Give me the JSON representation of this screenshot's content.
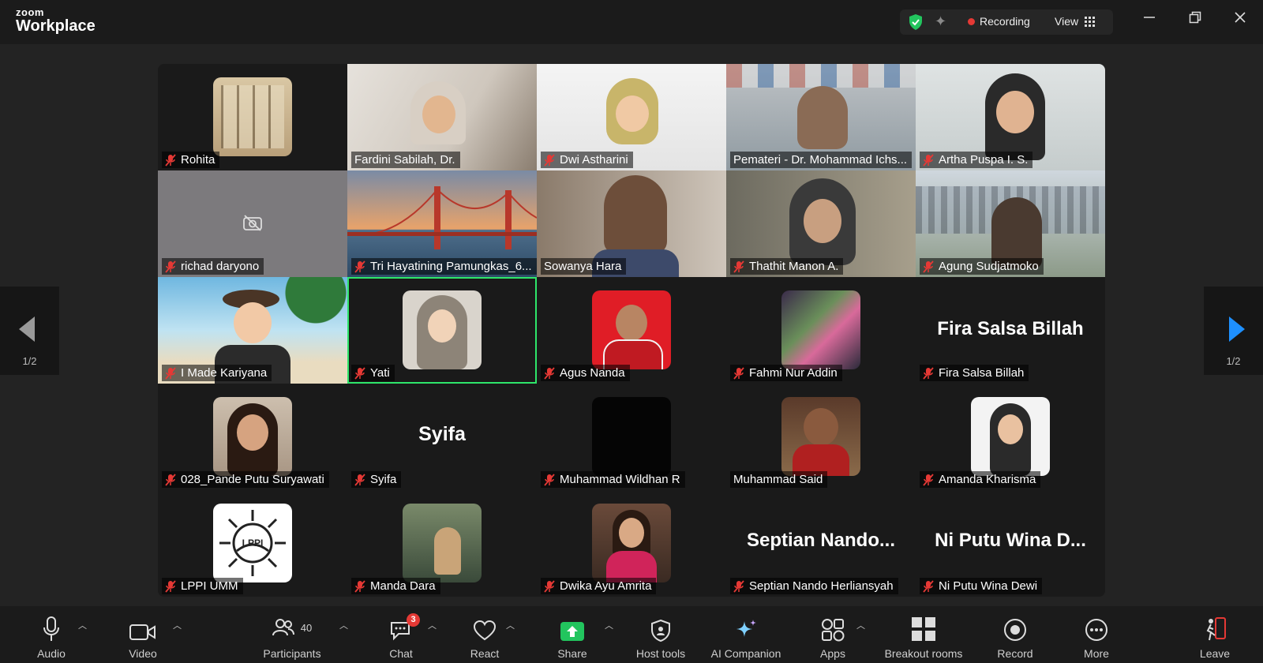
{
  "app": {
    "brand_small": "zoom",
    "brand_name": "Workplace"
  },
  "top": {
    "recording_label": "Recording",
    "view_label": "View"
  },
  "grid": {
    "page_indicator": "1/2"
  },
  "participants": [
    {
      "name": "Rohita",
      "muted": true
    },
    {
      "name": "Fardini Sabilah, Dr.",
      "muted": false
    },
    {
      "name": "Dwi Astharini",
      "muted": true
    },
    {
      "name": "Pemateri - Dr. Mohammad Ichs...",
      "muted": false
    },
    {
      "name": "Artha Puspa I. S.",
      "muted": true
    },
    {
      "name": "richad daryono",
      "muted": true
    },
    {
      "name": "Tri Hayatining Pamungkas_6...",
      "muted": true
    },
    {
      "name": "Sowanya Hara",
      "muted": false
    },
    {
      "name": "Thathit Manon A.",
      "muted": true
    },
    {
      "name": "Agung Sudjatmoko",
      "muted": true
    },
    {
      "name": "I Made Kariyana",
      "muted": true
    },
    {
      "name": "Yati",
      "muted": true
    },
    {
      "name": "Agus Nanda",
      "muted": true
    },
    {
      "name": "Fahmi Nur Addin",
      "muted": true
    },
    {
      "name": "Fira Salsa Billah",
      "muted": true,
      "display_name": "Fira Salsa Billah"
    },
    {
      "name": "028_Pande Putu Suryawati",
      "muted": true
    },
    {
      "name": "Syifa",
      "muted": true,
      "display_name": "Syifa"
    },
    {
      "name": "Muhammad Wildhan R",
      "muted": true
    },
    {
      "name": "Muhammad Said",
      "muted": false
    },
    {
      "name": "Amanda Kharisma",
      "muted": true
    },
    {
      "name": "LPPI UMM",
      "muted": true,
      "logo_text": "LPPI"
    },
    {
      "name": "Manda Dara",
      "muted": true
    },
    {
      "name": "Dwika Ayu Amrita",
      "muted": true
    },
    {
      "name": "Septian Nando Herliansyah",
      "muted": true,
      "display_name": "Septian  Nando..."
    },
    {
      "name": "Ni Putu Wina Dewi",
      "muted": true,
      "display_name": "Ni Putu Wina D..."
    }
  ],
  "toolbar": {
    "audio": "Audio",
    "video": "Video",
    "participants": "Participants",
    "participants_count": "40",
    "chat": "Chat",
    "chat_badge": "3",
    "react": "React",
    "share": "Share",
    "host_tools": "Host tools",
    "ai_companion": "AI Companion",
    "apps": "Apps",
    "breakout_rooms": "Breakout rooms",
    "record": "Record",
    "more": "More",
    "leave": "Leave"
  },
  "colors": {
    "accent_green": "#2ee66a",
    "share_green": "#22c55e",
    "mute_red": "#e53935",
    "arrow_blue": "#1e90ff"
  }
}
